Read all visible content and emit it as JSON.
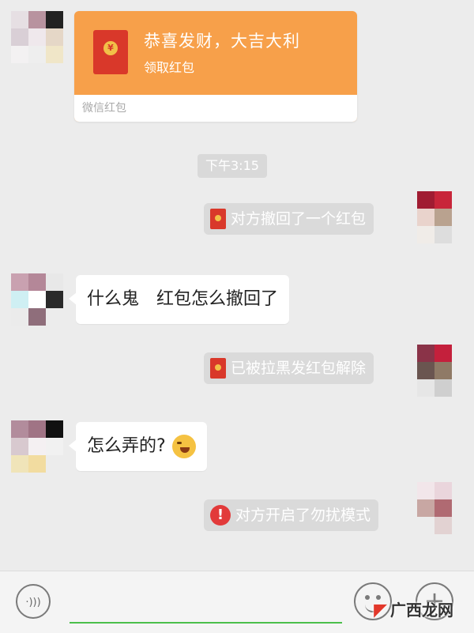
{
  "messages": {
    "red_packet": {
      "title": "恭喜发财，大吉大利",
      "subtitle": "领取红包",
      "footer": "微信红包",
      "coin_symbol": "¥"
    },
    "timestamp": "下午3:15",
    "system_1": "对方撤回了一个红包",
    "text_1": "什么鬼　红包怎么撤回了",
    "system_2": "已被拉黑发红包解除",
    "text_2": "怎么弄的?",
    "system_3": "对方开启了勿扰模式"
  },
  "input_bar": {
    "voice_icon": "·)))",
    "plus_icon": "+"
  },
  "watermark": {
    "text": "广西龙网"
  },
  "colors": {
    "red_packet_orange": "#f7a04a",
    "envelope_red": "#d9382a",
    "warning_red": "#e23a3a",
    "input_underline_green": "#4bbf4b"
  }
}
